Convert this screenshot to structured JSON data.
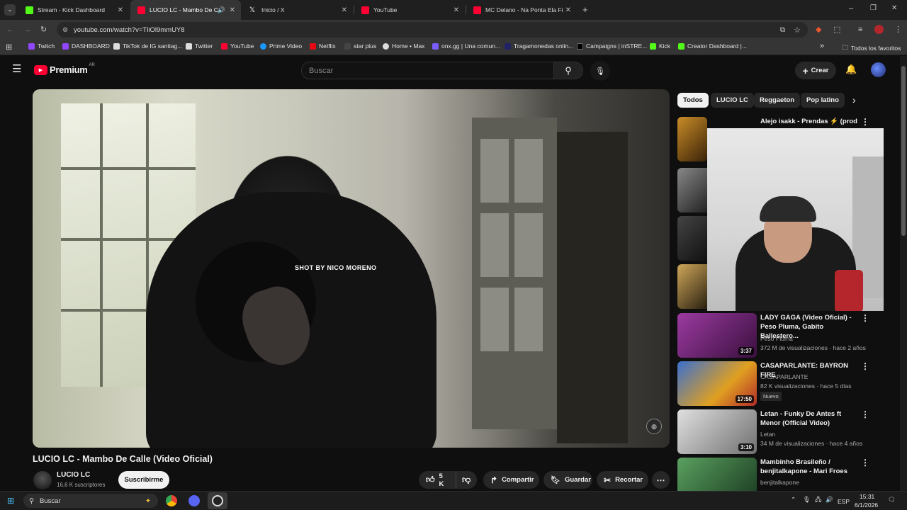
{
  "tabs": [
    {
      "title": "Stream - Kick Dashboard",
      "fav": "#53fc18"
    },
    {
      "title": "LUCIO LC - Mambo De Calle",
      "fav": "#ff0033"
    },
    {
      "title": "Inicio / X",
      "fav": "#ffffff"
    },
    {
      "title": "YouTube",
      "fav": "#ff0033"
    },
    {
      "title": "MC Delano - Na Ponta Ela Fica",
      "fav": "#ff0033"
    }
  ],
  "address": {
    "url": "youtube.com/watch?v=TliOl9mmUY8"
  },
  "bookmarks": [
    {
      "label": "Twitch",
      "fav": "#9146ff"
    },
    {
      "label": "DASHBOARD",
      "fav": "#9146ff"
    },
    {
      "label": "TikTok de IG santiag...",
      "fav": "#ffffff"
    },
    {
      "label": "Twitter",
      "fav": "#ffffff"
    },
    {
      "label": "YouTube",
      "fav": "#ff0033"
    },
    {
      "label": "Prime Video",
      "fav": "#1a98ff"
    },
    {
      "label": "Netflix",
      "fav": "#e50914"
    },
    {
      "label": "star plus",
      "fav": "#444444"
    },
    {
      "label": "Home • Max",
      "fav": "#ffffff"
    },
    {
      "label": "onx.gg | Una comun...",
      "fav": "#7a5cff"
    },
    {
      "label": "Tragamonedas onlin...",
      "fav": "#222266"
    },
    {
      "label": "Campaigns | inSTRE...",
      "fav": "#000000"
    },
    {
      "label": "Kick",
      "fav": "#53fc18"
    },
    {
      "label": "Creator Dashboard |...",
      "fav": "#53fc18"
    }
  ],
  "bookmarks_all": "Todos los favoritos",
  "yt": {
    "logo": "Premium",
    "region": "AR",
    "search_placeholder": "Buscar",
    "create_label": "Crear"
  },
  "video": {
    "overlay_text": "SHOT BY NICO MORENO",
    "title": "LUCIO LC - Mambo De Calle (Video Oficial)",
    "channel": "LUCIO LC",
    "subscribers": "16,6 K suscriptores",
    "subscribe_label": "Suscribirme",
    "likes": "5 K",
    "share_label": "Compartir",
    "save_label": "Guardar",
    "clip_label": "Recortar"
  },
  "chips": [
    "Todos",
    "LUCIO LC",
    "Reggaeton",
    "Pop latino"
  ],
  "recommendations": [
    {
      "title": "Alejo isakk - Prendas ⚡ (prod",
      "channel": "",
      "meta": "",
      "duration": "",
      "thumb": "#6b4a1a"
    },
    {
      "title": "LADY GAGA (Video Oficial) - Peso Pluma, Gabito Ballestero...",
      "channel": "Peso Pluma",
      "meta": "372 M de visualizaciones · hace 2 años",
      "duration": "3:37",
      "thumb": "#7a2a7a"
    },
    {
      "title": "CASAPARLANTE: BAYRON FIRE",
      "channel": "CASAPARLANTE",
      "meta": "82 K visualizaciones · hace 5 días",
      "badge": "Nuevo",
      "duration": "17:50",
      "thumb": "#3a6fd0"
    },
    {
      "title": "Letan - Funky De Antes ft Menor (Official Video)",
      "channel": "Letan",
      "meta": "34 M de visualizaciones · hace 4 años",
      "duration": "3:10",
      "thumb": "#d8d8d8"
    },
    {
      "title": "Mambinho Brasileño / benjitalkapone - Mari Froes",
      "channel": "benjitalkapone",
      "meta": "",
      "duration": "",
      "thumb": "#2f7a3a"
    }
  ],
  "taskbar": {
    "search_label": "Buscar",
    "lang": "ESP",
    "time": "15:31",
    "date": "6/1/2026"
  }
}
